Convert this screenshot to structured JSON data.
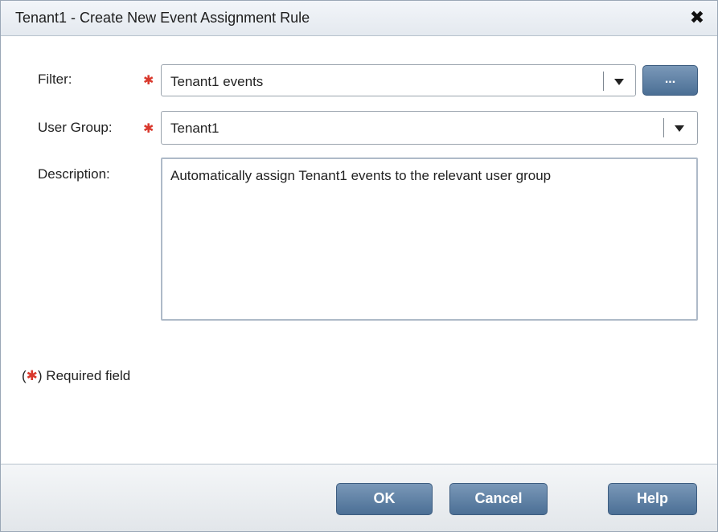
{
  "dialog": {
    "title": "Tenant1 - Create New Event Assignment Rule",
    "close_glyph": "✖"
  },
  "form": {
    "filter": {
      "label": "Filter:",
      "required_mark": "✱",
      "value": "Tenant1 events",
      "browse_label": "..."
    },
    "user_group": {
      "label": "User Group:",
      "required_mark": "✱",
      "value": "Tenant1"
    },
    "description": {
      "label": "Description:",
      "value": "Automatically assign Tenant1 events to the relevant user group"
    },
    "required_note": {
      "open": "(",
      "mark": "✱",
      "text": ") Required field"
    }
  },
  "footer": {
    "ok_label": "OK",
    "cancel_label": "Cancel",
    "help_label": "Help"
  },
  "colors": {
    "required": "#d9382c",
    "button": "#4b6f95"
  }
}
